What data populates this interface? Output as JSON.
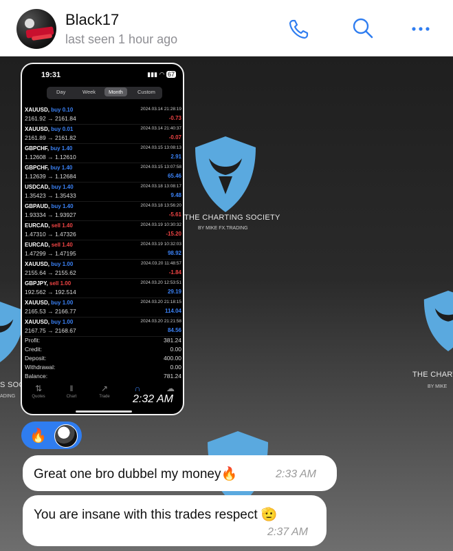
{
  "header": {
    "name": "Black17",
    "status": "last seen 1 hour ago",
    "icons": [
      "phone-icon",
      "search-icon",
      "more-icon"
    ],
    "accent": "#2f7df0"
  },
  "watermark": {
    "title": "THE CHARTING SOCIETY",
    "subtitle": "BY MIKE FX.TRADING",
    "left_fragment": "S SOC",
    "left_fragment_sub": "ADING",
    "right_fragment": "THE CHART",
    "right_fragment_sub": "BY MIKE"
  },
  "phone": {
    "time": "19:31",
    "battery": "67",
    "tabs": [
      "Day",
      "Week",
      "Month",
      "Custom"
    ],
    "active_tab": "Month",
    "trades": [
      {
        "symbol": "XAUUSD,",
        "side": "buy 0.10",
        "type": "buy",
        "prices": "2161.92 → 2161.84",
        "date": "2024.03.14 21:28:19",
        "pl": "-0.73"
      },
      {
        "symbol": "XAUUSD,",
        "side": "buy 0.01",
        "type": "buy",
        "prices": "2161.89 → 2161.82",
        "date": "2024.03.14 21:40:37",
        "pl": "-0.07"
      },
      {
        "symbol": "GBPCHF,",
        "side": "buy 1.40",
        "type": "buy",
        "prices": "1.12608 → 1.12610",
        "date": "2024.03.15 13:08:13",
        "pl": "2.91"
      },
      {
        "symbol": "GBPCHF,",
        "side": "buy 1.40",
        "type": "buy",
        "prices": "1.12639 → 1.12684",
        "date": "2024.03.15 13:07:58",
        "pl": "65.46"
      },
      {
        "symbol": "USDCAD,",
        "side": "buy 1.40",
        "type": "buy",
        "prices": "1.35423 → 1.35433",
        "date": "2024.03.18 13:08:17",
        "pl": "9.48"
      },
      {
        "symbol": "GBPAUD,",
        "side": "buy 1.40",
        "type": "buy",
        "prices": "1.93334 → 1.93927",
        "date": "2024.03.18 13:56:20",
        "pl": "-5.61"
      },
      {
        "symbol": "EURCAD,",
        "side": "sell 1.40",
        "type": "sell",
        "prices": "1.47310 → 1.47326",
        "date": "2024.03.19 10:30:32",
        "pl": "-15.20"
      },
      {
        "symbol": "EURCAD,",
        "side": "sell 1.40",
        "type": "sell",
        "prices": "1.47299 → 1.47195",
        "date": "2024.03.19 10:32:03",
        "pl": "98.92"
      },
      {
        "symbol": "XAUUSD,",
        "side": "buy 1.00",
        "type": "buy",
        "prices": "2155.64 → 2155.62",
        "date": "2024.03.20 11:48:57",
        "pl": "-1.84"
      },
      {
        "symbol": "GBPJPY,",
        "side": "sell 1.00",
        "type": "sell",
        "prices": "192.562 → 192.514",
        "date": "2024.03.20 12:53:51",
        "pl": "29.19"
      },
      {
        "symbol": "XAUUSD,",
        "side": "buy 1.00",
        "type": "buy",
        "prices": "2165.53 → 2166.77",
        "date": "2024.03.20 21:18:15",
        "pl": "114.04"
      },
      {
        "symbol": "XAUUSD,",
        "side": "buy 1.00",
        "type": "buy",
        "prices": "2167.75 → 2168.67",
        "date": "2024.03.20 21:21:58",
        "pl": "84.56"
      }
    ],
    "summary": [
      {
        "label": "Profit:",
        "value": "381.24"
      },
      {
        "label": "Credit:",
        "value": "0.00"
      },
      {
        "label": "Deposit:",
        "value": "400.00"
      },
      {
        "label": "Withdrawal:",
        "value": "0.00"
      },
      {
        "label": "Balance:",
        "value": "781.24"
      }
    ],
    "bottom_tabs": [
      "Quotes",
      "Chart",
      "Trade",
      "History",
      "Messages"
    ],
    "message_time": "2:32 AM"
  },
  "reactions": [
    "fire-emoji",
    "user-avatar"
  ],
  "messages": [
    {
      "text": "Great one bro dubbel my money🔥",
      "time": "2:33 AM"
    },
    {
      "text": "You are insane with this trades respect 🫡",
      "time": "2:37 AM"
    }
  ]
}
